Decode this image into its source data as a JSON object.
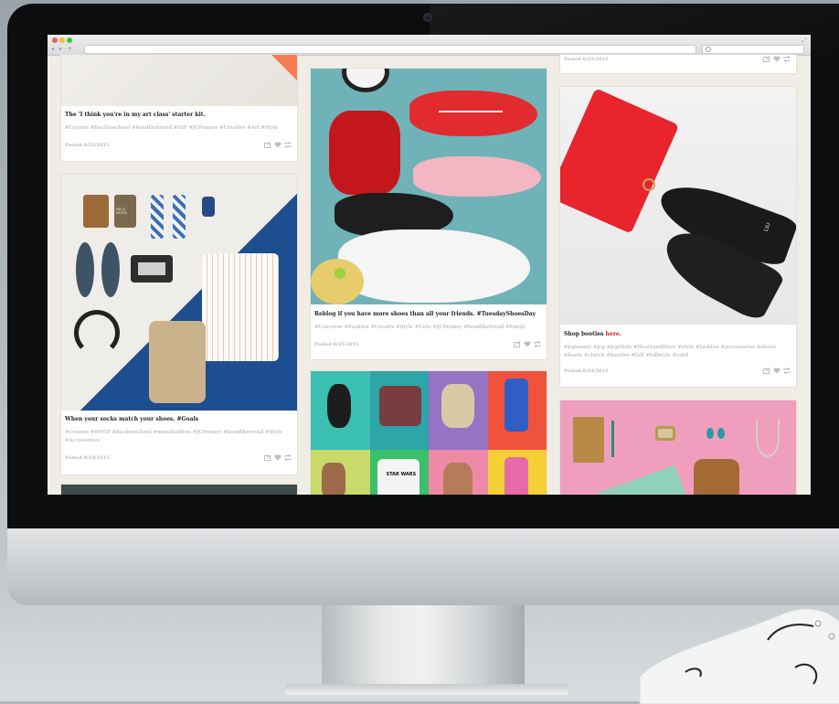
{
  "colors": {
    "background": "#aeb6bb",
    "bezel": "#0c0d0e",
    "page_background": "#f0ede6",
    "link_red": "#d4211c",
    "tag_gray": "#c3c3c3"
  },
  "browser": {
    "nav": "◂ ▸ +",
    "url": "",
    "search_placeholder": ""
  },
  "posts": [
    {
      "caption": "The 'I think you're in my art class' starter kit.",
      "tags": "#Creatrs #Backtoschool #bendthetrend #GIF #JCPenney #Creative #Art #Style",
      "posted": "Posted 8/25/2015"
    },
    {
      "caption": "When your socks match your shoes. #Goals",
      "tags": "#Creatrs #OOTD #Backtoschool #mensfashion #JCPenney #bendthetrend #Style #Accessories",
      "posted": "Posted 8/24/2015"
    },
    {
      "caption": "Reblog if you have more shoes than all your friends. #TuesdayShoesDay",
      "tags": "#Converse #Fashion #Creatrs #Style #Cute #JCPenney #bendthetrend #Emoji",
      "posted": "Posted 8/25/2015"
    },
    {
      "caption_before": "Shop booties ",
      "caption_link": "here",
      "caption_after": ".",
      "tags": "#jcpenney #jcp #jcpStyle #HeartandHave #style #fashion #accessories #shoes #boots #clutch #booties #fall #fallstyle #ootd",
      "posted": "Posted 8/24/2015"
    },
    {
      "posted": "Posted 8/25/2015"
    }
  ],
  "tile_labels": {
    "field_notes": "FIELD NOTES",
    "star_wars": "STAR WARS",
    "boot_brand": "LIU"
  },
  "icons": [
    "share-icon",
    "heart-icon",
    "reblog-icon"
  ]
}
